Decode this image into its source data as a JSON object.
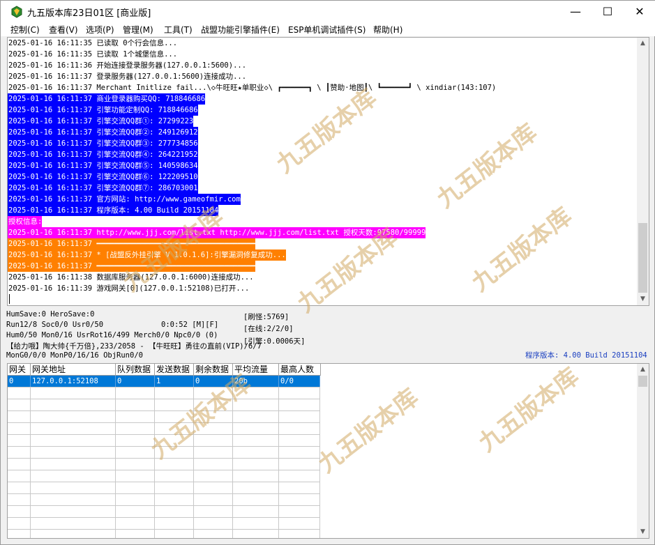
{
  "window": {
    "title": "九五版本库23日01区 [商业版]",
    "minimize": "—",
    "maximize": "☐",
    "close": "✕"
  },
  "menu": [
    "控制(C)",
    "查看(V)",
    "选项(P)",
    "管理(M)",
    "工具(T)",
    "战盟功能引擎插件(E)",
    "ESP单机调试插件(S)",
    "帮助(H)"
  ],
  "log": [
    {
      "text": "2025-01-16 16:11:35 已读取 0个行会信息...",
      "hl": ""
    },
    {
      "text": "2025-01-16 16:11:35 已读取 1个城堡信息...",
      "hl": ""
    },
    {
      "text": "2025-01-16 16:11:36 开始连接登录服务器(127.0.0.1:5600)...",
      "hl": ""
    },
    {
      "text": "2025-01-16 16:11:37 登录服务器(127.0.0.1:5600)连接成功...",
      "hl": ""
    },
    {
      "text": "2025-01-16 16:11:37 Merchant Initlize fail...\\◇牛旺旺★单职业◇\\ ┏━━━━━━┓ \\ ┃赞助·地图┃\\ ┗━━━━━━┛ \\ xindiar(143:107)",
      "hl": ""
    },
    {
      "text": "2025-01-16 16:11:37 商业登录器购买QQ: 718846686",
      "hl": "blue"
    },
    {
      "text": "2025-01-16 16:11:37 引擎功能定制QQ: 718846686",
      "hl": "blue"
    },
    {
      "text": "2025-01-16 16:11:37 引擎交流QQ群①: 27299223",
      "hl": "blue"
    },
    {
      "text": "2025-01-16 16:11:37 引擎交流QQ群②: 249126912",
      "hl": "blue"
    },
    {
      "text": "2025-01-16 16:11:37 引擎交流QQ群③: 277734856",
      "hl": "blue"
    },
    {
      "text": "2025-01-16 16:11:37 引擎交流QQ群④: 264221952",
      "hl": "blue"
    },
    {
      "text": "2025-01-16 16:11:37 引擎交流QQ群⑤: 140598634",
      "hl": "blue"
    },
    {
      "text": "2025-01-16 16:11:37 引擎交流QQ群⑥: 122209510",
      "hl": "blue"
    },
    {
      "text": "2025-01-16 16:11:37 引擎交流QQ群⑦: 286703001",
      "hl": "blue"
    },
    {
      "text": "2025-01-16 16:11:37 官方网站: http://www.gameofmir.com",
      "hl": "blue"
    },
    {
      "text": "2025-01-16 16:11:37 程序版本: 4.00 Build 20151104",
      "hl": "blue"
    },
    {
      "text": "授权信息:",
      "hl": "mag"
    },
    {
      "text": "2025-01-16 16:11:37 http://www.jjj.com/list.txt http://www.jjj.com/list.txt 授权天数:97580/99999",
      "hl": "mag"
    },
    {
      "text": "2025-01-16 16:11:37 ━━━━━━━━━━━━━━━━━━━━━━━━━━━━━━━━━━━━",
      "hl": "ora"
    },
    {
      "text": "2025-01-16 16:11:37 * [战盟反外挂引擎 V 1.0.1.6]:引擎漏洞修复成功...",
      "hl": "ora"
    },
    {
      "text": "2025-01-16 16:11:37 ━━━━━━━━━━━━━━━━━━━━━━━━━━━━━━━━━━━━",
      "hl": "ora"
    },
    {
      "text": "2025-01-16 16:11:38 数据库服务器(127.0.0.1:6000)连接成功...",
      "hl": ""
    },
    {
      "text": "2025-01-16 16:11:39 游戏网关[0](127.0.0.1:52108)已打开...",
      "hl": ""
    }
  ],
  "status": {
    "line1": "HumSave:0 HeroSave:0",
    "line2": "Run12/8 Soc0/0 Usr0/50",
    "time": "0:0:52 [M][F]",
    "line3": "Hum0/50 Mon0/16 UsrRot16/499 Merch0/0 Npc0/0 (0)",
    "line4": "【给力哦】陶大帅{千万倍},233/2058 - 【牛旺旺】勇往の直前(VIP)/6/7",
    "line5": "MonG0/0/0 MonP0/16/16 ObjRun0/0",
    "refresh": "[刷怪:5769]",
    "online": "[在线:2/2/0]",
    "engine": "[引擎:0.0006天]",
    "version": "程序版本: 4.00 Build 20151104"
  },
  "grid": {
    "headers": [
      "网关",
      "网关地址",
      "队列数据",
      "发送数据",
      "剩余数据",
      "平均流量",
      "最高人数"
    ],
    "rows": [
      [
        "0",
        "127.0.0.1:52108",
        "0",
        "1",
        "0",
        "20b",
        "0/0"
      ]
    ]
  },
  "watermark": "九五版本库"
}
